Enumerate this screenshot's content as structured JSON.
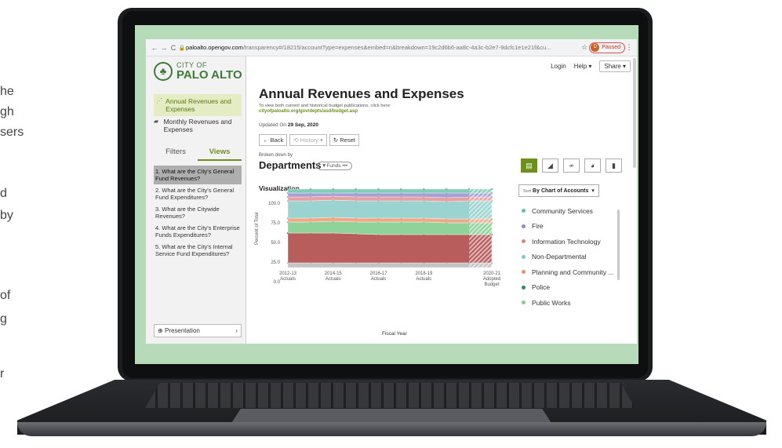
{
  "background_fragments": [
    "he",
    "gh",
    "sers",
    "d",
    "by",
    "of",
    "g",
    "r"
  ],
  "browser": {
    "url_host": "paloalto.opengov.com",
    "url_rest": "/transparency#/18215/accountType=expenses&embed=n&breakdown=19c2d6b6-aa8c-4a3c-b2e7-9dcfc1e1e21f&cu...",
    "paused_label": "Paused",
    "avatar_letter": "D"
  },
  "logo": {
    "line1": "CITY OF",
    "line2": "PALO ALTO"
  },
  "sidebar": {
    "nav": [
      {
        "label": "Annual Revenues and Expenses",
        "icon": "trend-icon"
      },
      {
        "label": "Monthly Revenues and Expenses",
        "icon": "bar-chart-icon"
      }
    ],
    "tabs": [
      "Filters",
      "Views"
    ],
    "views": [
      "1. What are the City's General Fund Revenues?",
      "2. What are the City's General Fund Expenditures?",
      "3. What are the Citywide Revenues?",
      "4. What are the City's Enterprise Funds Expenditures?",
      "5. What are the City's Internal Service Fund Expenditures?"
    ],
    "presentation": "Presentation"
  },
  "topnav": {
    "login": "Login",
    "help": "Help",
    "share": "Share"
  },
  "main": {
    "title": "Annual Revenues and Expenses",
    "sub1": "To view both current and historical budget publications, click here:",
    "sub2": "cityofpaloalto.org/gov/depts/asd/budget.asp",
    "updated_prefix": "Updated On",
    "updated_date": "29 Sep, 2020",
    "back": "Back",
    "history": "History",
    "reset": "Reset",
    "broken_down_by": "Broken down by",
    "breakdown": "Departments",
    "funds_filter": "Funds",
    "visualization": "Visualization",
    "sort_prefix": "Sort",
    "sort_value": "By Chart of Accounts"
  },
  "chart_data": {
    "type": "area",
    "stacked": true,
    "ylabel": "Percent of Total",
    "xlabel": "Fiscal Year",
    "ylim": [
      0,
      100
    ],
    "yticks": [
      "100.0",
      "75.0",
      "50.0",
      "25.0",
      "0.0"
    ],
    "x_labels": [
      {
        "line1": "2012-13",
        "line2": "Actuals",
        "line3": ""
      },
      {
        "line1": "2014-15",
        "line2": "Actuals",
        "line3": ""
      },
      {
        "line1": "2016-17",
        "line2": "Actuals",
        "line3": ""
      },
      {
        "line1": "2018-19",
        "line2": "Actuals",
        "line3": ""
      },
      {
        "line1": "2020-21",
        "line2": "Adopted",
        "line3": "Budget"
      }
    ],
    "points": 10,
    "label_indices": [
      0,
      2,
      4,
      6,
      9
    ],
    "projection_from_index": 8,
    "series": [
      {
        "color": "#c4c4c4",
        "values": [
          6,
          6,
          6,
          6,
          6,
          6,
          6,
          6,
          6,
          6
        ]
      },
      {
        "color": "#b85c5c",
        "values": [
          38,
          38,
          38,
          37,
          36,
          36,
          36,
          36,
          36,
          36
        ]
      },
      {
        "color": "#8fd39b",
        "values": [
          14,
          14,
          15,
          15,
          16,
          16,
          16,
          15,
          15,
          15
        ]
      },
      {
        "color": "#f0a987",
        "values": [
          5,
          5,
          5,
          5,
          5,
          5,
          5,
          5,
          5,
          5
        ]
      },
      {
        "color": "#9ad3d0",
        "values": [
          22,
          22,
          22,
          22,
          22,
          22,
          22,
          22,
          23,
          23
        ]
      },
      {
        "color": "#e8a0a0",
        "values": [
          5,
          5,
          5,
          5,
          5,
          5,
          5,
          5,
          5,
          5
        ]
      },
      {
        "color": "#a7a0d8",
        "values": [
          5,
          5,
          4,
          5,
          5,
          5,
          5,
          6,
          5,
          5
        ]
      },
      {
        "color": "#7fcfb8",
        "values": [
          5,
          5,
          5,
          5,
          5,
          5,
          5,
          5,
          5,
          5
        ]
      }
    ]
  },
  "legend": [
    {
      "label": "Community Services",
      "color": "#66c2a5"
    },
    {
      "label": "Fire",
      "color": "#8f86c8"
    },
    {
      "label": "Information Technology",
      "color": "#e57f7f"
    },
    {
      "label": "Non-Departmental",
      "color": "#7bc8c2"
    },
    {
      "label": "Planning and Community ...",
      "color": "#f08e67"
    },
    {
      "label": "Police",
      "color": "#2e8b57"
    },
    {
      "label": "Public Works",
      "color": "#7fcf8b"
    }
  ]
}
